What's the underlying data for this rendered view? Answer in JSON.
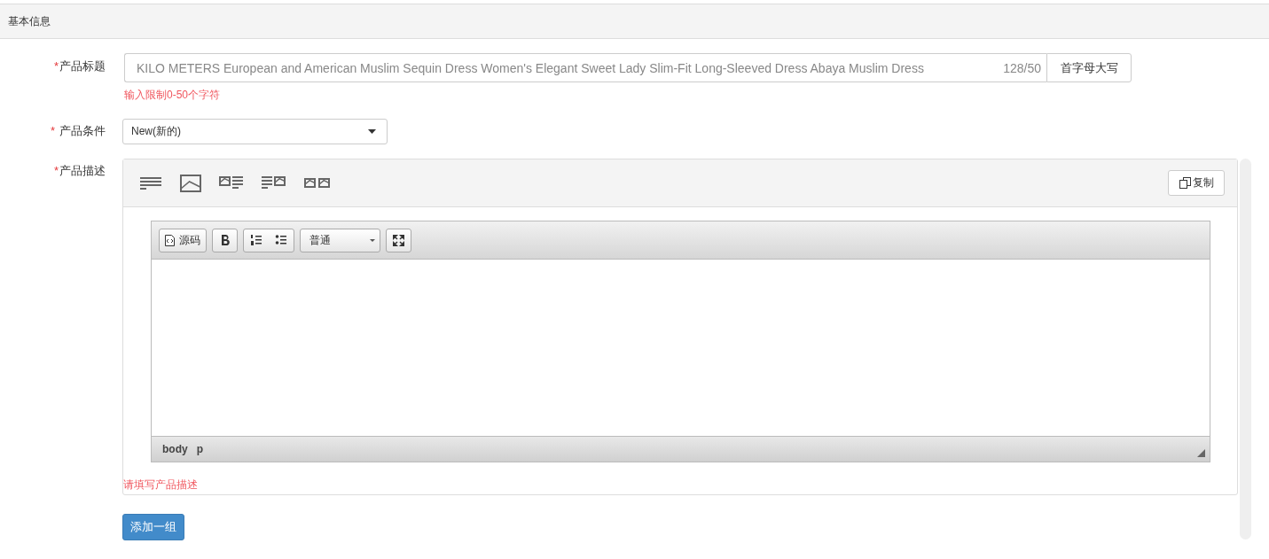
{
  "section": {
    "title": "基本信息"
  },
  "fields": [
    {
      "kind": "title",
      "required_mark": "*",
      "label": "产品标题",
      "value": "KILO METERS European and American Muslim Sequin Dress Women's Elegant Sweet Lady Slim-Fit Long-Sleeved Dress Abaya Muslim Dress",
      "counter": "128/50",
      "button": "首字母大写",
      "hint": "输入限制0-50个字符"
    },
    {
      "kind": "select",
      "required_mark": "*",
      "label": "产品条件",
      "value": "New(新的)"
    },
    {
      "kind": "editor",
      "required_mark": "*",
      "label": "产品描述",
      "copy_button": "复制",
      "source_button": "源码",
      "format": "普通",
      "path": [
        "body",
        "p"
      ],
      "error": "请填写产品描述"
    }
  ],
  "add_button": "添加一组"
}
